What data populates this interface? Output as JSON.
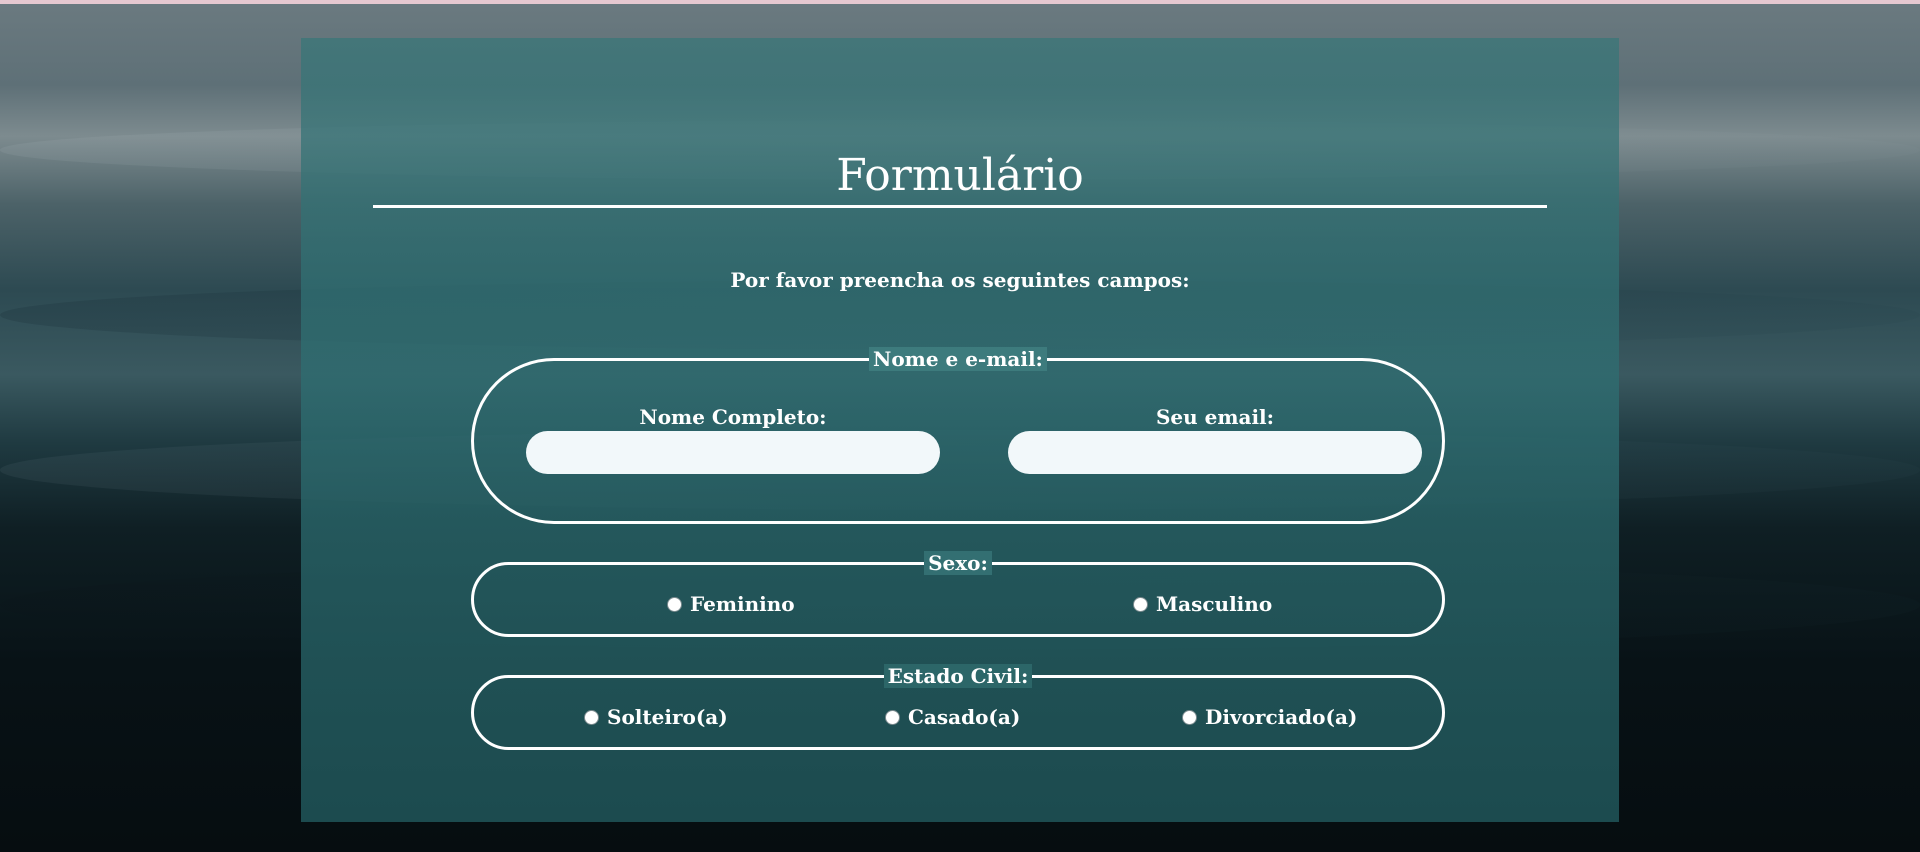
{
  "form": {
    "title": "Formulário",
    "subtitle": "Por favor preencha os seguintes campos:",
    "contact_group": {
      "legend": "Nome e e-mail:",
      "name_label": "Nome Completo:",
      "name_value": "",
      "email_label": "Seu email:",
      "email_value": ""
    },
    "sex_group": {
      "legend": "Sexo:",
      "options": [
        "Feminino",
        "Masculino"
      ]
    },
    "civil_group": {
      "legend": "Estado Civil:",
      "options": [
        "Solteiro(a)",
        "Casado(a)",
        "Divorciado(a)"
      ]
    }
  },
  "colors": {
    "panel_overlay": "#377678",
    "text": "#ffffff",
    "input_bg": "#f2f8fa",
    "top_strip": "#e6c8d0"
  }
}
